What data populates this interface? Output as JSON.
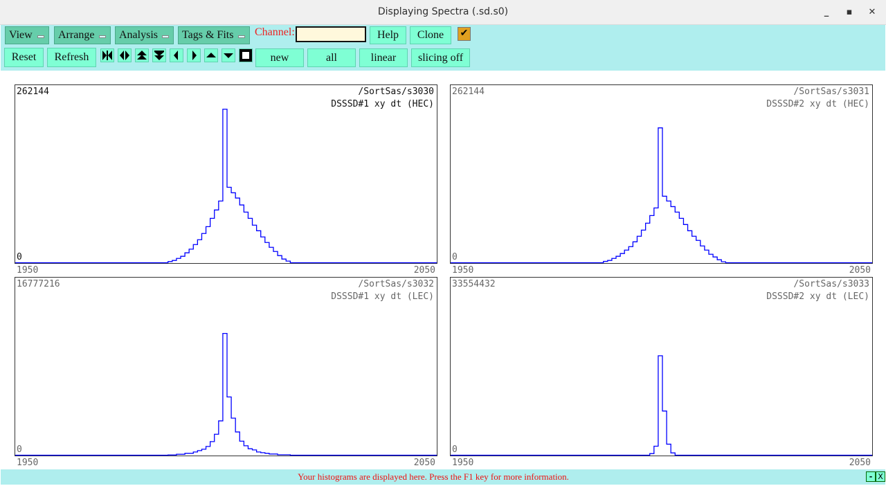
{
  "window": {
    "title": "Displaying Spectra (.sd.s0)",
    "minimize": "_",
    "maximize": "▪",
    "close": "✕"
  },
  "toolbar": {
    "menus": [
      "View",
      "Arrange",
      "Analysis",
      "Tags & Fits"
    ],
    "channel_label": "Channel:",
    "channel_value": "",
    "help": "Help",
    "clone": "Clone",
    "checkbox_checked": true,
    "check": "✔",
    "reset": "Reset",
    "refresh": "Refresh",
    "nav_icons": [
      "expand-horizontal-icon",
      "shrink-horizontal-icon",
      "expand-vertical-icon",
      "shrink-vertical-icon",
      "scroll-left-icon",
      "scroll-right-icon",
      "scroll-up-icon",
      "scroll-down-icon",
      "square-icon"
    ],
    "new": "new",
    "all": "all",
    "linear": "linear",
    "slicing": "slicing off"
  },
  "status": {
    "message": "Your histograms are displayed here. Press the F1 key for more information.",
    "min": "-",
    "close": "X"
  },
  "colors": {
    "line": "#0000ff",
    "accent": "#7fffd4",
    "menu": "#66cdaa",
    "toolbar": "#afeeee",
    "status_text": "#ee1111"
  },
  "chart_data": [
    {
      "type": "histogram",
      "name": "/SortSas/s3030",
      "title": "DSSSD#1 xy dt (HEC)",
      "ymax_label": "262144",
      "ymin_label": "0",
      "ylim": [
        0,
        262144
      ],
      "xlim": [
        1950,
        2050
      ],
      "x_ticks": [
        "1950",
        "2050"
      ],
      "x": [
        1986,
        1987,
        1988,
        1989,
        1990,
        1991,
        1992,
        1993,
        1994,
        1995,
        1996,
        1997,
        1998,
        1999,
        2000,
        2001,
        2002,
        2003,
        2004,
        2005,
        2006,
        2007,
        2008,
        2009,
        2010,
        2011,
        2012,
        2013,
        2014
      ],
      "values": [
        1700,
        3400,
        6400,
        9500,
        14600,
        20000,
        26800,
        33900,
        43100,
        53200,
        65400,
        77700,
        90900,
        226200,
        111200,
        103100,
        95300,
        85100,
        74600,
        65400,
        55300,
        47100,
        38000,
        29800,
        22700,
        16600,
        10500,
        5400,
        2400
      ]
    },
    {
      "type": "histogram",
      "name": "/SortSas/s3031",
      "title": "DSSSD#2 xy dt (HEC)",
      "ymax_label": "262144",
      "ymin_label": "0",
      "ylim": [
        0,
        262144
      ],
      "xlim": [
        1950,
        2050
      ],
      "x_ticks": [
        "1950",
        "2050"
      ],
      "x": [
        1986,
        1987,
        1988,
        1989,
        1990,
        1991,
        1992,
        1993,
        1994,
        1995,
        1996,
        1997,
        1998,
        1999,
        2000,
        2001,
        2002,
        2003,
        2004,
        2005,
        2006,
        2007,
        2008,
        2009,
        2010,
        2011,
        2012,
        2013,
        2014
      ],
      "values": [
        2000,
        3400,
        6400,
        9500,
        13600,
        18600,
        23700,
        30800,
        39000,
        48100,
        58300,
        69500,
        80700,
        198700,
        98000,
        90900,
        82700,
        74600,
        65400,
        56300,
        47100,
        39000,
        32900,
        24700,
        18600,
        12500,
        8500,
        4400,
        1400
      ]
    },
    {
      "type": "histogram",
      "name": "/SortSas/s3032",
      "title": "DSSSD#1 xy dt (LEC)",
      "ymax_label": "16777216",
      "ymin_label": "0",
      "ylim": [
        0,
        16777216
      ],
      "xlim": [
        1950,
        2050
      ],
      "x_ticks": [
        "1950",
        "2050"
      ],
      "x": [
        1986,
        1987,
        1988,
        1989,
        1990,
        1991,
        1992,
        1993,
        1994,
        1995,
        1996,
        1997,
        1998,
        1999,
        2000,
        2001,
        2002,
        2003,
        2004,
        2005,
        2006,
        2007,
        2008,
        2009,
        2010,
        2011,
        2012,
        2013,
        2014
      ],
      "values": [
        22000,
        22000,
        87000,
        87000,
        174000,
        174000,
        304000,
        434000,
        564000,
        825000,
        1281000,
        1975000,
        3234000,
        11481000,
        5491000,
        3494000,
        2192000,
        1324000,
        890000,
        608000,
        499000,
        304000,
        239000,
        174000,
        109000,
        109000,
        43000,
        43000,
        43000
      ]
    },
    {
      "type": "histogram",
      "name": "/SortSas/s3033",
      "title": "DSSSD#2 xy dt (LEC)",
      "ymax_label": "33554432",
      "ymin_label": "0",
      "ylim": [
        0,
        33554432
      ],
      "xlim": [
        1950,
        2050
      ],
      "x_ticks": [
        "1950",
        "2050"
      ],
      "x": [
        1997,
        1998,
        1999,
        2000,
        2001,
        2002
      ],
      "values": [
        304000,
        1693000,
        18752000,
        8334000,
        2084000,
        434000
      ]
    }
  ]
}
